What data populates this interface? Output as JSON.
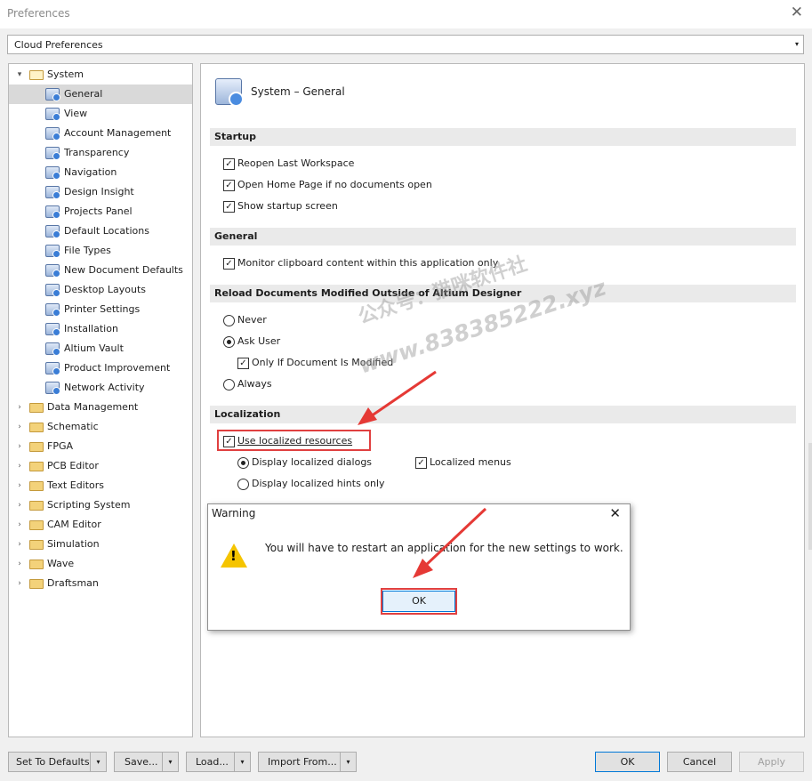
{
  "window": {
    "title": "Preferences",
    "close_glyph": "✕"
  },
  "profile_combo": {
    "value": "Cloud Preferences",
    "arrow": "▾"
  },
  "tree": {
    "system": {
      "label": "System",
      "expanded": true
    },
    "children": [
      "General",
      "View",
      "Account Management",
      "Transparency",
      "Navigation",
      "Design Insight",
      "Projects Panel",
      "Default Locations",
      "File Types",
      "New Document Defaults",
      "Desktop Layouts",
      "Printer Settings",
      "Installation",
      "Altium Vault",
      "Product Improvement",
      "Network Activity"
    ],
    "selected": "General",
    "groups": [
      "Data Management",
      "Schematic",
      "FPGA",
      "PCB Editor",
      "Text Editors",
      "Scripting System",
      "CAM Editor",
      "Simulation",
      "Wave",
      "Draftsman"
    ]
  },
  "page": {
    "title": "System – General",
    "startup": {
      "header": "Startup",
      "options": [
        {
          "label": "Reopen Last Workspace",
          "checked": true
        },
        {
          "label": "Open Home Page if no documents open",
          "checked": true
        },
        {
          "label": "Show startup screen",
          "checked": true
        }
      ]
    },
    "general": {
      "header": "General",
      "options": [
        {
          "label": "Monitor clipboard content within this application only",
          "checked": true
        }
      ]
    },
    "reload": {
      "header": "Reload Documents Modified Outside of Altium Designer",
      "never": "Never",
      "ask_user": "Ask User",
      "only_if_modified": "Only If Document Is Modified",
      "always": "Always",
      "selected": "Ask User"
    },
    "localization": {
      "header": "Localization",
      "use_localized": "Use localized resources",
      "display_dialogs": "Display localized dialogs",
      "display_hints": "Display localized hints only",
      "localized_menus": "Localized menus"
    }
  },
  "watermark": {
    "line1": "公众号：猫咪软件社",
    "line2": "www.838385222.xyz"
  },
  "warning_dialog": {
    "title": "Warning",
    "close_glyph": "✕",
    "message": "You will have to restart an application for the new settings to work.",
    "ok_label": "OK",
    "icon": "warning-icon"
  },
  "footer": {
    "set_defaults": "Set To Defaults",
    "save": "Save...",
    "load": "Load...",
    "import_from": "Import From...",
    "ok": "OK",
    "cancel": "Cancel",
    "apply": "Apply",
    "dropdown_glyph": "▾"
  },
  "colors": {
    "highlight": "#e04040",
    "accent": "#0078d7",
    "section_bg": "#eaeaea"
  }
}
